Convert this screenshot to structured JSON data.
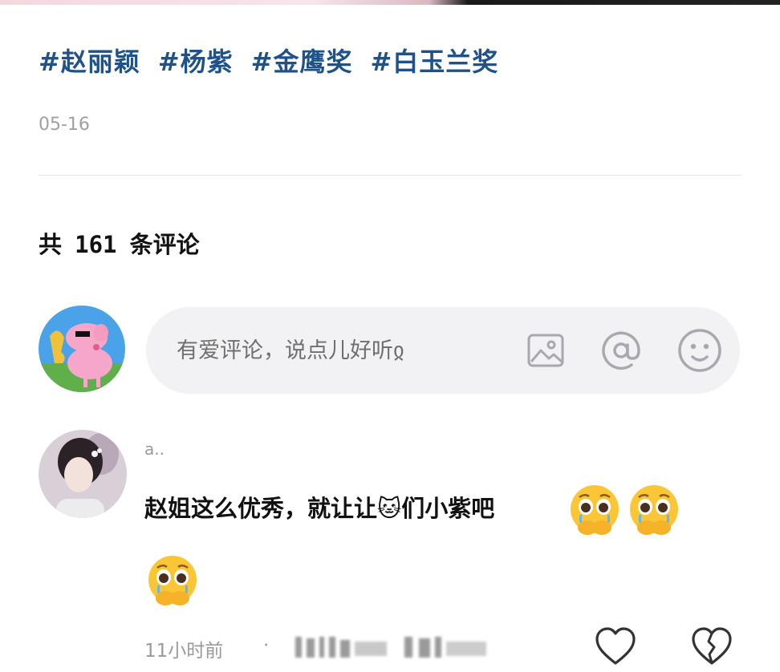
{
  "post": {
    "tags": [
      "#赵丽颖",
      "#杨紫",
      "#金鹰奖",
      "#白玉兰奖"
    ],
    "date": "05-16"
  },
  "comments_section": {
    "count_prefix": "共",
    "count": "161",
    "count_suffix": "条评论",
    "input_placeholder": "有爱评论，说点儿好听ჲ",
    "icons": [
      "image-icon",
      "at-icon",
      "emoji-icon"
    ]
  },
  "comment": {
    "username": "a..",
    "text": "赵姐这么优秀，就让让🐱们小紫吧",
    "emojis": [
      "pleading-face-emoji",
      "pleading-face-emoji",
      "pleading-face-emoji"
    ],
    "time": "11小时前",
    "separator": "·"
  },
  "colors": {
    "tag": "#1f5288",
    "input_bg": "#f2f2f4",
    "muted": "#9a9a9a"
  }
}
